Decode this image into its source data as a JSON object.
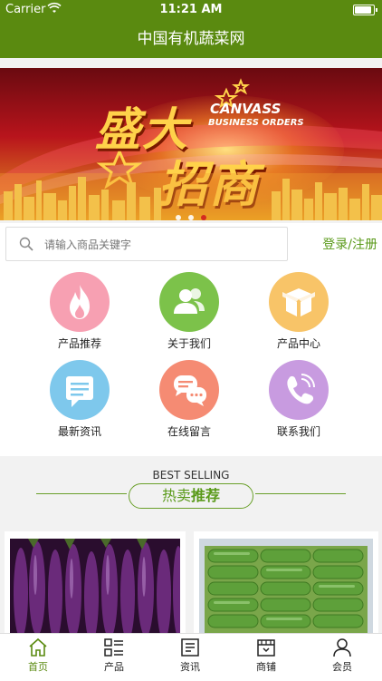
{
  "status": {
    "carrier": "Carrier",
    "time": "11:21 AM"
  },
  "header": {
    "title": "中国有机蔬菜网"
  },
  "banner": {
    "headline_top": "盛大",
    "headline_bottom": "招商",
    "latin_line1": "CANVASS",
    "latin_line2": "BUSINESS ORDERS",
    "dots": 3,
    "active_dot": 3
  },
  "search": {
    "placeholder": "请输入商品关键字",
    "login_label": "登录/注册"
  },
  "menu": {
    "items": [
      {
        "label": "产品推荐",
        "color": "#f7a0b2",
        "icon": "flame-icon"
      },
      {
        "label": "关于我们",
        "color": "#7cc24a",
        "icon": "users-icon"
      },
      {
        "label": "产品中心",
        "color": "#f8c468",
        "icon": "box-icon"
      },
      {
        "label": "最新资讯",
        "color": "#7ec8ec",
        "icon": "message-icon"
      },
      {
        "label": "在线留言",
        "color": "#f58b73",
        "icon": "chat-icon"
      },
      {
        "label": "联系我们",
        "color": "#c89be0",
        "icon": "phone-icon"
      }
    ]
  },
  "section": {
    "english": "BEST SELLING",
    "chinese_part1": "热卖",
    "chinese_part2": "推荐"
  },
  "products": [
    {
      "name": "eggplant",
      "icon": "eggplant-image"
    },
    {
      "name": "cucumber",
      "icon": "cucumber-image"
    }
  ],
  "tabbar": {
    "items": [
      {
        "label": "首页",
        "icon": "home-icon",
        "active": true
      },
      {
        "label": "产品",
        "icon": "grid-list-icon",
        "active": false
      },
      {
        "label": "资讯",
        "icon": "news-icon",
        "active": false
      },
      {
        "label": "商铺",
        "icon": "shop-icon",
        "active": false
      },
      {
        "label": "会员",
        "icon": "person-icon",
        "active": false
      }
    ]
  },
  "colors": {
    "brand": "#5a8a10",
    "accent_green": "#5a9a1a",
    "page_bg": "#f2f2f2"
  }
}
